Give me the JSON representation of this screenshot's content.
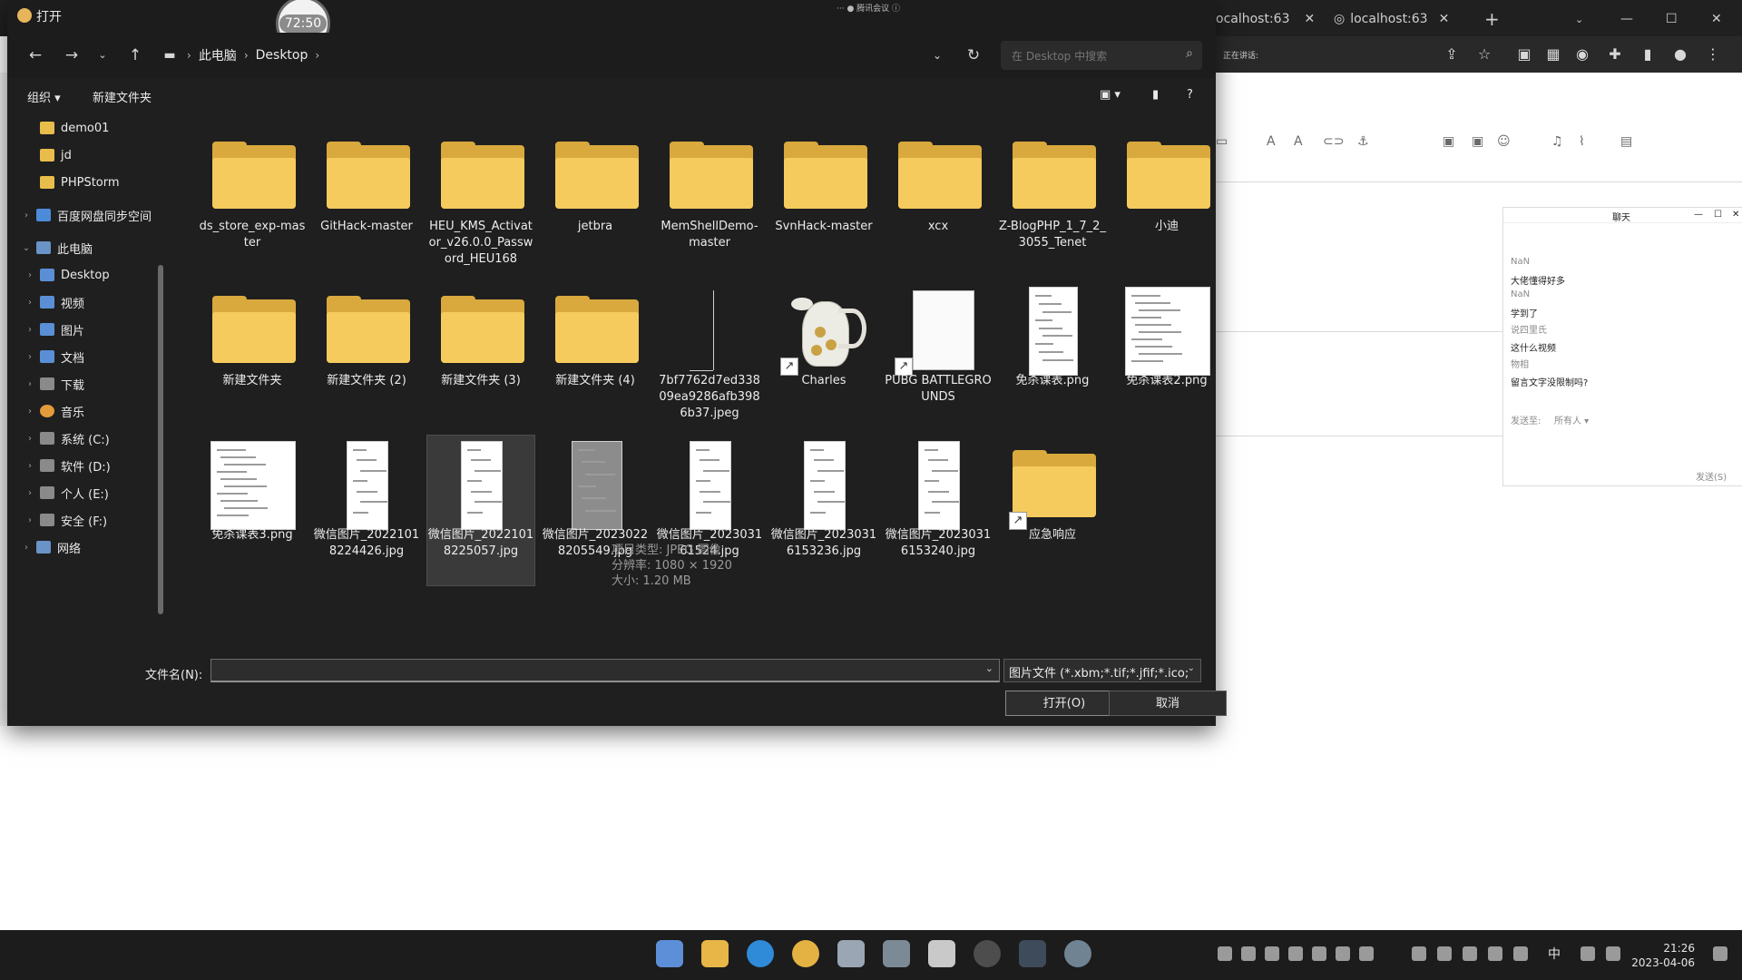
{
  "dialog": {
    "title": "打开",
    "timer": "72:50",
    "meeting_label": "··· ● 腾讯会议 ⓘ",
    "breadcrumb": [
      "此电脑",
      "Desktop"
    ],
    "search_placeholder": "在 Desktop 中搜索",
    "organize_label": "组织 ▾",
    "new_folder_label": "新建文件夹",
    "tooltip": {
      "type": "项目类型: JPEG 图像",
      "resolution": "分辨率: 1080 × 1920",
      "size": "大小: 1.20 MB"
    },
    "filename_label": "文件名(N):",
    "filename_value": "",
    "filter_label": "图片文件 (*.xbm;*.tif;*.jfif;*.ico;",
    "open_label": "打开(O)",
    "cancel_label": "取消"
  },
  "sidebar": [
    {
      "label": "demo01",
      "icon": "folder-icon",
      "indent": 1
    },
    {
      "label": "jd",
      "icon": "folder-icon",
      "indent": 1
    },
    {
      "label": "PHPStorm",
      "icon": "folder-icon",
      "indent": 1
    },
    {
      "label": "百度网盘同步空间",
      "icon": "cloud-icon",
      "indent": 0
    },
    {
      "label": "此电脑",
      "icon": "computer-icon",
      "indent": 0
    },
    {
      "label": "Desktop",
      "icon": "desktop-icon",
      "indent": 1
    },
    {
      "label": "视频",
      "icon": "video-icon",
      "indent": 1
    },
    {
      "label": "图片",
      "icon": "picture-icon",
      "indent": 1
    },
    {
      "label": "文档",
      "icon": "document-icon",
      "indent": 1
    },
    {
      "label": "下载",
      "icon": "download-icon",
      "indent": 1
    },
    {
      "label": "音乐",
      "icon": "music-icon",
      "indent": 1
    },
    {
      "label": "系统 (C:)",
      "icon": "drive-icon",
      "indent": 1
    },
    {
      "label": "软件 (D:)",
      "icon": "drive-icon",
      "indent": 1
    },
    {
      "label": "个人 (E:)",
      "icon": "drive-icon",
      "indent": 1
    },
    {
      "label": "安全 (F:)",
      "icon": "drive-icon",
      "indent": 1
    },
    {
      "label": "网络",
      "icon": "network-icon",
      "indent": 0
    }
  ],
  "files": [
    {
      "name": "ds_store_exp-master",
      "kind": "folder"
    },
    {
      "name": "GitHack-master",
      "kind": "folder"
    },
    {
      "name": "HEU_KMS_Activator_v26.0.0_Password_HEU168",
      "kind": "folder"
    },
    {
      "name": "jetbra",
      "kind": "folder"
    },
    {
      "name": "MemShellDemo-master",
      "kind": "folder"
    },
    {
      "name": "SvnHack-master",
      "kind": "folder"
    },
    {
      "name": "xcx",
      "kind": "folder"
    },
    {
      "name": "Z-BlogPHP_1_7_2_3055_Tenet",
      "kind": "folder"
    },
    {
      "name": "小迪",
      "kind": "folder"
    },
    {
      "name": "新建文件夹",
      "kind": "folder"
    },
    {
      "name": "新建文件夹 (2)",
      "kind": "folder"
    },
    {
      "name": "新建文件夹 (3)",
      "kind": "folder"
    },
    {
      "name": "新建文件夹 (4)",
      "kind": "folder"
    },
    {
      "name": "7bf7762d7ed33809ea9286afb3986b37.jpeg",
      "kind": "blank"
    },
    {
      "name": "Charles",
      "kind": "pitcher"
    },
    {
      "name": "PUBG BATTLEGROUNDS",
      "kind": "page-shortcut"
    },
    {
      "name": "免杀课表.png",
      "kind": "doc"
    },
    {
      "name": "免杀课表2.png",
      "kind": "doc-wide"
    },
    {
      "name": "免杀课表3.png",
      "kind": "doc-wide"
    },
    {
      "name": "微信图片_20221018224426.jpg",
      "kind": "phone"
    },
    {
      "name": "微信图片_20221018225057.jpg",
      "kind": "phone"
    },
    {
      "name": "微信图片_20230228205549.jpg",
      "kind": "phone-dark"
    },
    {
      "name": "微信图片_202303161524.jpg",
      "kind": "phone"
    },
    {
      "name": "微信图片_20230316153236.jpg",
      "kind": "phone"
    },
    {
      "name": "微信图片_20230316153240.jpg",
      "kind": "phone"
    },
    {
      "name": "应急响应",
      "kind": "folder-shortcut"
    }
  ],
  "browser": {
    "tab1": "ocalhost:63",
    "tab2": "localhost:63",
    "page_note": "正在讲话:"
  },
  "chat": {
    "title": "聊天",
    "lines": [
      "NaN",
      "大佬懂得好多",
      "NaN",
      "学到了",
      "说四里氏",
      "这什么视频",
      "物相",
      "留言文字没限制吗?"
    ],
    "send_to_label": "发送至:",
    "send_to_value": "所有人 ▾",
    "send_label": "发送(S)"
  },
  "taskbar": {
    "ime": "中",
    "time": "21:26",
    "date": "2023-04-06"
  },
  "colors": {
    "dialog_bg": "#1f1f1f",
    "folder_yellow": "#f6cb5d",
    "taskbar_bg": "#1c1c1c"
  }
}
